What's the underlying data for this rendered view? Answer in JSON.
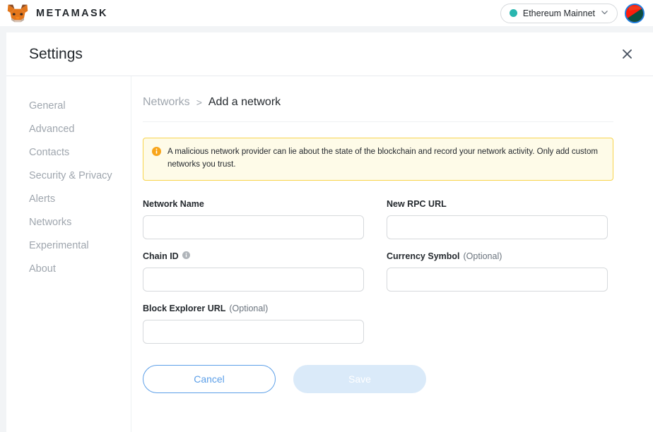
{
  "header": {
    "brand_name": "METAMASK",
    "logo_icon": "metamask-fox-icon",
    "network": {
      "label": "Ethereum Mainnet",
      "dot_color": "#29b6af",
      "chevron_icon": "chevron-down-icon"
    },
    "account_avatar_icon": "account-identicon"
  },
  "settings": {
    "title": "Settings",
    "close_icon": "close-icon"
  },
  "sidebar": {
    "items": [
      {
        "label": "General",
        "name": "general"
      },
      {
        "label": "Advanced",
        "name": "advanced"
      },
      {
        "label": "Contacts",
        "name": "contacts"
      },
      {
        "label": "Security & Privacy",
        "name": "security-privacy"
      },
      {
        "label": "Alerts",
        "name": "alerts"
      },
      {
        "label": "Networks",
        "name": "networks"
      },
      {
        "label": "Experimental",
        "name": "experimental"
      },
      {
        "label": "About",
        "name": "about"
      }
    ]
  },
  "breadcrumb": {
    "parent": "Networks",
    "separator": ">",
    "current": "Add a network"
  },
  "warning": {
    "icon": "info-circle-icon",
    "icon_color": "#f8a51b",
    "background": "#fefbe8",
    "border_color": "#f8d44c",
    "text": "A malicious network provider can lie about the state of the blockchain and record your network activity. Only add custom networks you trust."
  },
  "form": {
    "fields": [
      {
        "name": "network-name",
        "label": "Network Name",
        "optional_suffix": "",
        "has_info_icon": false,
        "value": "",
        "placeholder": ""
      },
      {
        "name": "new-rpc-url",
        "label": "New RPC URL",
        "optional_suffix": "",
        "has_info_icon": false,
        "value": "",
        "placeholder": ""
      },
      {
        "name": "chain-id",
        "label": "Chain ID",
        "optional_suffix": "",
        "has_info_icon": true,
        "value": "",
        "placeholder": ""
      },
      {
        "name": "currency-symbol",
        "label": "Currency Symbol",
        "optional_suffix": "(Optional)",
        "has_info_icon": false,
        "value": "",
        "placeholder": ""
      },
      {
        "name": "block-explorer-url",
        "label": "Block Explorer URL",
        "optional_suffix": "(Optional)",
        "has_info_icon": false,
        "value": "",
        "placeholder": ""
      }
    ],
    "info_icon": "info-circle-icon"
  },
  "actions": {
    "cancel_label": "Cancel",
    "save_label": "Save",
    "accent_color": "#5c9fe8",
    "save_disabled_bg": "#daeaf9"
  }
}
